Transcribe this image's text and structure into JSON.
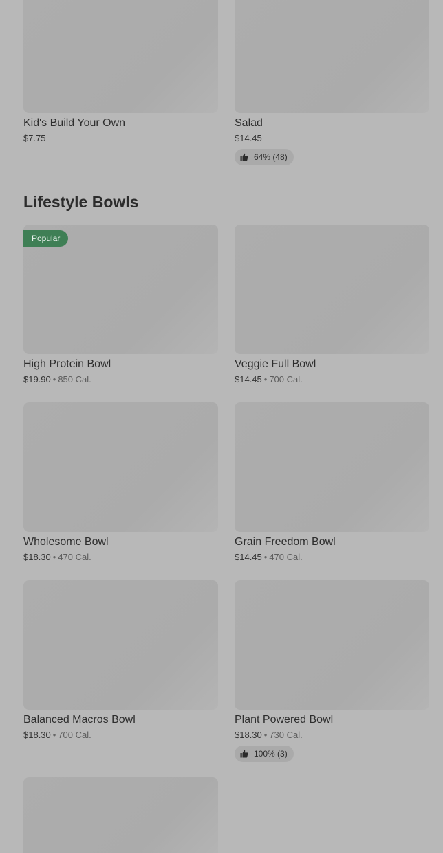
{
  "top_items": [
    {
      "name": "Kid's Build Your Own",
      "price": "$7.75"
    },
    {
      "name": "Salad",
      "price": "$14.45",
      "rating": "64% (48)"
    }
  ],
  "section": {
    "title": "Lifestyle Bowls"
  },
  "bowls": [
    {
      "name": "High Protein Bowl",
      "price": "$19.90",
      "calories": "850 Cal.",
      "badge": "Popular"
    },
    {
      "name": "Veggie Full Bowl",
      "price": "$14.45",
      "calories": "700 Cal."
    },
    {
      "name": "Wholesome Bowl",
      "price": "$18.30",
      "calories": "470 Cal."
    },
    {
      "name": "Grain Freedom Bowl",
      "price": "$14.45",
      "calories": "470 Cal."
    },
    {
      "name": "Balanced Macros Bowl",
      "price": "$18.30",
      "calories": "700 Cal."
    },
    {
      "name": "Plant Powered Bowl",
      "price": "$18.30",
      "calories": "730 Cal.",
      "rating": "100% (3)"
    }
  ],
  "icons": {
    "rating": "thumbs-up-icon",
    "separator": "•"
  }
}
